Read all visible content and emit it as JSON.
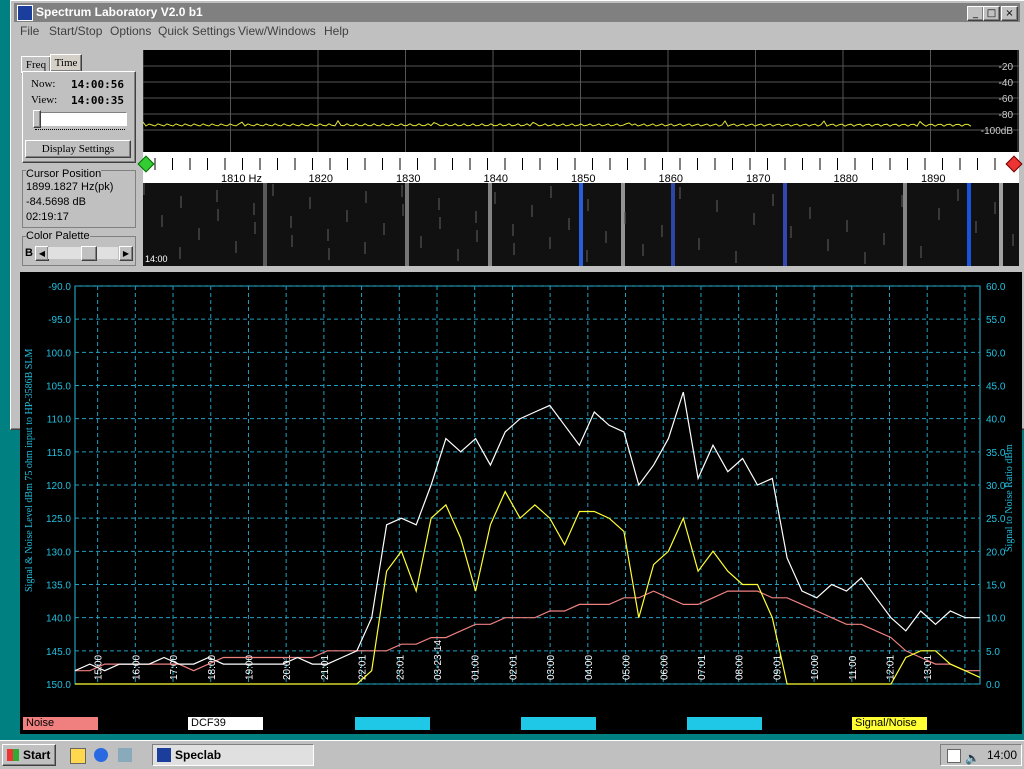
{
  "app": {
    "title": "Spectrum Laboratory V2.0 b1"
  },
  "menu": [
    "File",
    "Start/Stop",
    "Options",
    "Quick Settings",
    "View/Windows",
    "Help"
  ],
  "left_panel": {
    "tabs": [
      "Freq",
      "Time"
    ],
    "now_label": "Now:",
    "now_value": "14:00:56",
    "view_label": "View:",
    "view_value": "14:00:35",
    "display_settings": "Display Settings",
    "cursor_title": "Cursor Position",
    "cursor_freq": "1899.1827 Hz(pk)",
    "cursor_level": "-84.5698 dB",
    "cursor_time": "02:19:17",
    "palette_title": "Color Palette",
    "palette_b": "B"
  },
  "spectrum": {
    "db_labels": [
      "-20",
      "-40",
      "-60",
      "-80",
      "-100dB"
    ],
    "freq_labels": [
      "1810 Hz",
      "1820",
      "1830",
      "1840",
      "1850",
      "1860",
      "1870",
      "1880",
      "1890"
    ],
    "waterfall_time": "14:00"
  },
  "chart_data": {
    "type": "line",
    "ylabel_left": "Signal & Noise Level  dBm 75 ohm input to HP-3586B SLM",
    "ylabel_right": "Signal to Noise Ratio  dBm",
    "ylim_left": [
      -150,
      -90
    ],
    "ylim_right": [
      0,
      60
    ],
    "yticks_left": [
      "-90.0",
      "-95.0",
      "100.0",
      "105.0",
      "110.0",
      "115.0",
      "120.0",
      "125.0",
      "130.0",
      "135.0",
      "140.0",
      "145.0",
      "150.0"
    ],
    "yticks_right": [
      "60.0",
      "55.0",
      "50.0",
      "45.0",
      "40.0",
      "35.0",
      "30.0",
      "25.0",
      "20.0",
      "15.0",
      "10.0",
      "5.0",
      "0.0"
    ],
    "xticks": [
      "15:00",
      "16:00",
      "17:00",
      "18:00",
      "19:00",
      "20:01",
      "21:01",
      "22:01",
      "23:01",
      "03-23-14",
      "01:00",
      "02:01",
      "03:00",
      "04:00",
      "05:00",
      "06:00",
      "07:01",
      "08:00",
      "09:01",
      "10:00",
      "11:00",
      "12:01",
      "13:01"
    ],
    "series": [
      {
        "name": "Noise",
        "color": "#f08080",
        "values": [
          -148,
          -148,
          -147,
          -147,
          -147,
          -147,
          -147,
          -147,
          -148,
          -147,
          -146,
          -146,
          -146,
          -146,
          -146,
          -146,
          -146,
          -145,
          -145,
          -145,
          -145,
          -145,
          -144,
          -144,
          -143,
          -143,
          -142,
          -141,
          -141,
          -140,
          -140,
          -140,
          -139,
          -139,
          -138,
          -138,
          -138,
          -137,
          -137,
          -136,
          -137,
          -138,
          -138,
          -137,
          -136,
          -136,
          -136,
          -137,
          -137,
          -138,
          -139,
          -140,
          -141,
          -141,
          -142,
          -143,
          -145,
          -146,
          -147,
          -147,
          -148,
          -148
        ]
      },
      {
        "name": "DCF39",
        "color": "#ffffff",
        "values": [
          -148,
          -147,
          -148,
          -147,
          -147,
          -147,
          -146,
          -147,
          -147,
          -146,
          -147,
          -147,
          -147,
          -147,
          -147,
          -146,
          -147,
          -147,
          -146,
          -145,
          -140,
          -126,
          -125,
          -126,
          -120,
          -113,
          -115,
          -113,
          -117,
          -112,
          -110,
          -109,
          -108,
          -111,
          -114,
          -109,
          -111,
          -112,
          -120,
          -117,
          -113,
          -106,
          -119,
          -114,
          -118,
          -116,
          -120,
          -119,
          -131,
          -136,
          -137,
          -135,
          -136,
          -134,
          -137,
          -140,
          -142,
          -139,
          -141,
          -139,
          -140,
          -140
        ]
      },
      {
        "name": "Signal/Noise",
        "color": "#ffff33",
        "values": [
          0,
          0,
          0,
          0,
          0,
          0,
          0,
          0,
          0,
          0,
          0,
          0,
          0,
          0,
          0,
          0,
          0,
          0,
          0,
          0,
          2,
          17,
          20,
          14,
          25,
          27,
          22,
          14,
          24,
          29,
          25,
          27,
          25,
          21,
          26,
          26,
          25,
          23,
          10,
          18,
          20,
          25,
          17,
          20,
          17,
          15,
          15,
          10,
          0,
          0,
          0,
          0,
          0,
          0,
          0,
          0,
          4,
          5,
          5,
          3,
          2,
          1
        ]
      }
    ],
    "legend": [
      "Noise",
      "DCF39",
      "",
      "",
      "",
      "Signal/Noise"
    ],
    "legend_colors": [
      "#f08080",
      "#ffffff",
      "#1ec8e6",
      "#1ec8e6",
      "#1ec8e6",
      "#ffff33"
    ],
    "grid": true
  },
  "taskbar": {
    "start": "Start",
    "task": "Speclab",
    "clock": "14:00"
  }
}
